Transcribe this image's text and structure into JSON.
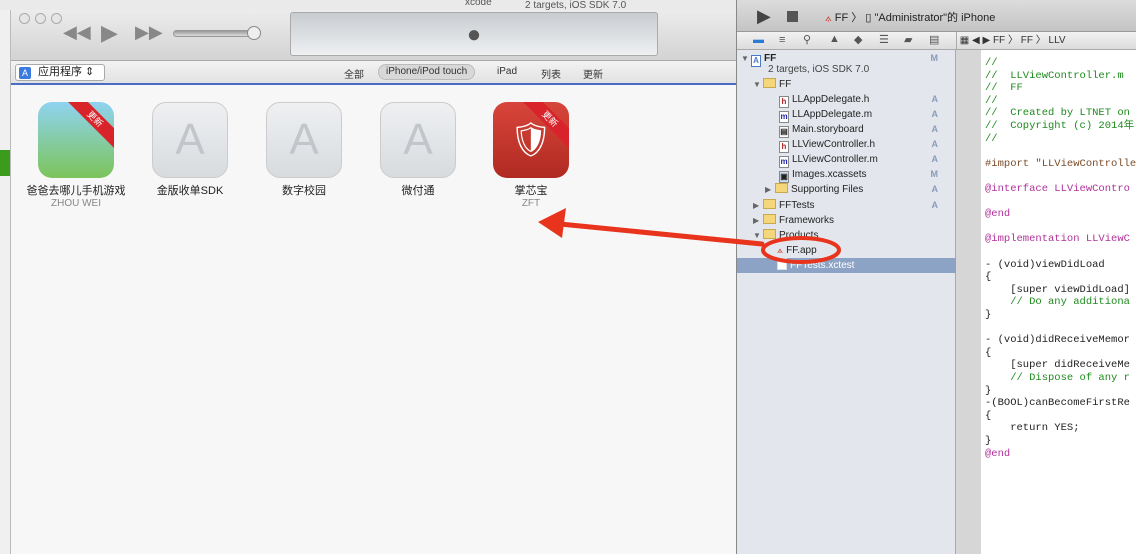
{
  "background": {
    "title_fragment": "xcode",
    "scheme_fragment": "2 targets, iOS SDK 7.0"
  },
  "itunes": {
    "library_selector": "应用程序",
    "segments": [
      "全部",
      "iPhone/iPod touch",
      "iPad",
      "列表",
      "更新"
    ],
    "active_segment": "iPhone/iPod touch",
    "apps": [
      {
        "name": "爸爸去哪儿手机游戏",
        "developer": "ZHOU WEI",
        "badge": "更新",
        "icon": "game-icon"
      },
      {
        "name": "金版收单SDK",
        "developer": "",
        "badge": "",
        "icon": "app-store-placeholder-icon"
      },
      {
        "name": "数字校园",
        "developer": "",
        "badge": "",
        "icon": "app-store-placeholder-icon"
      },
      {
        "name": "微付通",
        "developer": "",
        "badge": "",
        "icon": "app-store-placeholder-icon"
      },
      {
        "name": "掌芯宝",
        "developer": "ZFT",
        "badge": "更新",
        "icon": "paw-shield-icon"
      }
    ]
  },
  "xcode": {
    "scheme": "FF",
    "device": "\"Administrator\"的 iPhone",
    "jump_bar": [
      "FF",
      "FF",
      "LLV"
    ],
    "navigator": [
      {
        "label": "FF",
        "status": "M",
        "type": "project"
      },
      {
        "label": "2 targets, iOS SDK 7.0",
        "status": "",
        "type": "subtitle"
      },
      {
        "label": "FF",
        "status": "",
        "type": "folder"
      },
      {
        "label": "LLAppDelegate.h",
        "status": "A",
        "type": "h"
      },
      {
        "label": "LLAppDelegate.m",
        "status": "A",
        "type": "m"
      },
      {
        "label": "Main.storyboard",
        "status": "A",
        "type": "sb"
      },
      {
        "label": "LLViewController.h",
        "status": "A",
        "type": "h"
      },
      {
        "label": "LLViewController.m",
        "status": "A",
        "type": "m"
      },
      {
        "label": "Images.xcassets",
        "status": "M",
        "type": "assets"
      },
      {
        "label": "Supporting Files",
        "status": "A",
        "type": "folder"
      },
      {
        "label": "FFTests",
        "status": "A",
        "type": "folder"
      },
      {
        "label": "Frameworks",
        "status": "",
        "type": "folder"
      },
      {
        "label": "Products",
        "status": "",
        "type": "folder"
      },
      {
        "label": "FF.app",
        "status": "",
        "type": "app"
      },
      {
        "label": "FFTests.xctest",
        "status": "",
        "type": "test"
      }
    ],
    "selected_item": "FFTests.xctest",
    "highlighted_item": "FF.app",
    "code": [
      "//",
      "//  LLViewController.m",
      "//  FF",
      "//",
      "//  Created by LTNET on",
      "//  Copyright (c) 2014年",
      "//",
      "",
      "#import \"LLViewControlle",
      "",
      "@interface LLViewContro",
      "",
      "@end",
      "",
      "@implementation LLViewC",
      "",
      "- (void)viewDidLoad",
      "{",
      "    [super viewDidLoad]",
      "    // Do any additiona",
      "}",
      "",
      "- (void)didReceiveMemor",
      "{",
      "    [super didReceiveMe",
      "    // Dispose of any r",
      "}",
      "-(BOOL)canBecomeFirstRe",
      "{",
      "    return YES;",
      "}",
      "@end"
    ]
  },
  "colors": {
    "annotation": "#e8341c",
    "selection": "#8da3c6",
    "accent": "#4a6cc4"
  }
}
